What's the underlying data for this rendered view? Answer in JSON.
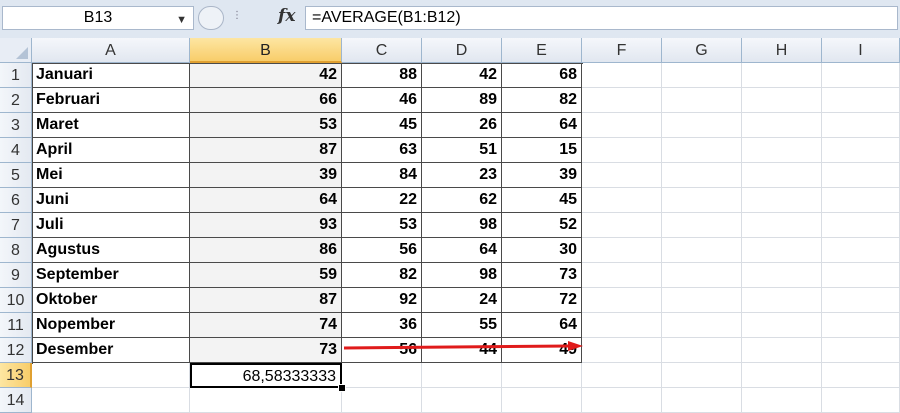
{
  "formula_bar": {
    "name_box": "B13",
    "formula": "=AVERAGE(B1:B12)"
  },
  "columns": [
    "A",
    "B",
    "C",
    "D",
    "E",
    "F",
    "G",
    "H",
    "I"
  ],
  "active_column": "B",
  "row_numbers": [
    "1",
    "2",
    "3",
    "4",
    "5",
    "6",
    "7",
    "8",
    "9",
    "10",
    "11",
    "12",
    "13",
    "14"
  ],
  "active_row": "13",
  "rows": [
    {
      "month": "Januari",
      "b": "42",
      "c": "88",
      "d": "42",
      "e": "68"
    },
    {
      "month": "Februari",
      "b": "66",
      "c": "46",
      "d": "89",
      "e": "82"
    },
    {
      "month": "Maret",
      "b": "53",
      "c": "45",
      "d": "26",
      "e": "64"
    },
    {
      "month": "April",
      "b": "87",
      "c": "63",
      "d": "51",
      "e": "15"
    },
    {
      "month": "Mei",
      "b": "39",
      "c": "84",
      "d": "23",
      "e": "39"
    },
    {
      "month": "Juni",
      "b": "64",
      "c": "22",
      "d": "62",
      "e": "45"
    },
    {
      "month": "Juli",
      "b": "93",
      "c": "53",
      "d": "98",
      "e": "52"
    },
    {
      "month": "Agustus",
      "b": "86",
      "c": "56",
      "d": "64",
      "e": "30"
    },
    {
      "month": "September",
      "b": "59",
      "c": "82",
      "d": "98",
      "e": "73"
    },
    {
      "month": "Oktober",
      "b": "87",
      "c": "92",
      "d": "24",
      "e": "72"
    },
    {
      "month": "Nopember",
      "b": "74",
      "c": "36",
      "d": "55",
      "e": "64"
    },
    {
      "month": "Desember",
      "b": "73",
      "c": "56",
      "d": "44",
      "e": "49"
    }
  ],
  "result_cell": "68,58333333",
  "colors": {
    "arrow": "#e01b1b",
    "active_header": "#f8cd6a",
    "header_bg": "#e1e7f0"
  }
}
